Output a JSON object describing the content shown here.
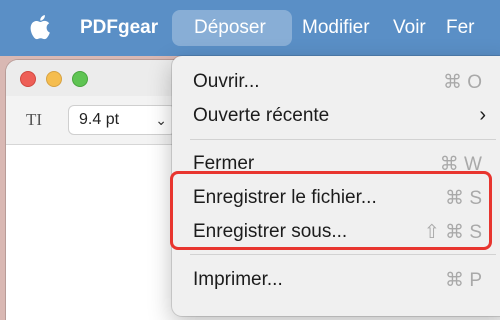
{
  "menubar": {
    "apple_icon": "apple-icon",
    "app_name": "PDFgear",
    "items": [
      "Déposer",
      "Modifier",
      "Voir",
      "Fer"
    ]
  },
  "window": {
    "toolbar": {
      "text_tool_icon": "text-cursor-icon",
      "text_tool_label": "TI",
      "font_size": "9.4 pt",
      "chevron": "⌄"
    }
  },
  "file_menu": {
    "items": [
      {
        "label": "Ouvrir...",
        "shortcut": "⌘ O"
      },
      {
        "label": "Ouverte récente",
        "shortcut": "›"
      },
      {
        "label": "Fermer",
        "shortcut": "⌘ W"
      },
      {
        "label": "Enregistrer le fichier...",
        "shortcut": "⌘ S"
      },
      {
        "label": "Enregistrer sous...",
        "shortcut": "⇧ ⌘ S"
      },
      {
        "label": "Imprimer...",
        "shortcut": "⌘ P"
      }
    ]
  },
  "colors": {
    "menubar_bg": "#5a8fc6",
    "menu_bg": "#f0f0f0",
    "highlight_border": "#e8352f"
  }
}
